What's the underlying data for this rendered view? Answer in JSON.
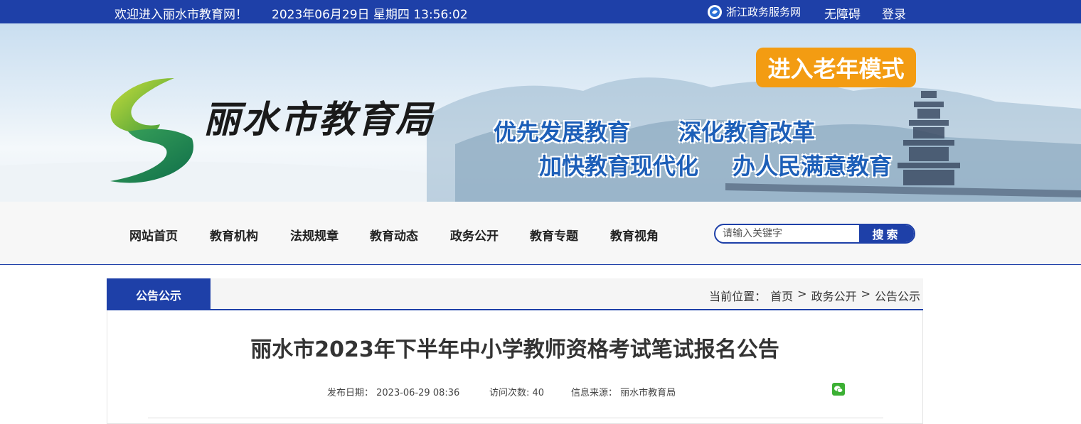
{
  "topbar": {
    "welcome": "欢迎进入丽水市教育网！",
    "datetime": "2023年06月29日 星期四 13:56:02",
    "zj_service": "浙江政务服务网",
    "accessibility": "无障碍",
    "login": "登录"
  },
  "banner": {
    "logo_text": "丽水市教育局",
    "elder_mode": "进入老年模式",
    "slogans": [
      "优先发展教育",
      "深化教育改革",
      "加快教育现代化",
      "办人民满意教育"
    ]
  },
  "nav": {
    "items": [
      "网站首页",
      "教育机构",
      "法规规章",
      "教育动态",
      "政务公开",
      "教育专题",
      "教育视角"
    ],
    "search_placeholder": "请输入关键字",
    "search_button": "搜索"
  },
  "content": {
    "section_tab": "公告公示",
    "breadcrumb": {
      "prefix": "当前位置：",
      "items": [
        "首页",
        "政务公开",
        "公告公示"
      ],
      "separator": ">"
    },
    "title": "丽水市2023年下半年中小学教师资格考试笔试报名公告",
    "meta": {
      "publish_date": "发布日期：  2023-06-29  08:36",
      "visits": "访问次数: 40",
      "source": "信息来源：  丽水市教育局"
    }
  },
  "colors": {
    "primary": "#1e40a8",
    "elder_button": "#f39c12",
    "slogan": "#1d5fb8"
  }
}
